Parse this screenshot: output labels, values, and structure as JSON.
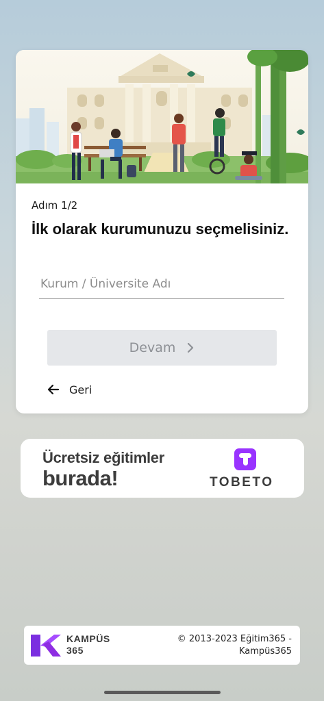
{
  "card": {
    "step_label": "Adım 1/2",
    "title": "İlk olarak kurumunuzu seçmelisiniz.",
    "institution_input": {
      "placeholder": "Kurum / Üniversite Adı",
      "value": ""
    },
    "continue_label": "Devam",
    "back_label": "Geri"
  },
  "banner": {
    "line1": "Ücretsiz eğitimler",
    "line2": "burada!",
    "brand": "TOBETO",
    "brand_color": "#9933ff"
  },
  "footer": {
    "brand_line1": "KAMPÜS",
    "brand_line2": "365",
    "copyright": "© 2013-2023 Eğitim365 - Kampüs365",
    "logo_color": "#8e2de2"
  },
  "icons": {
    "continue": "chevron-right-icon",
    "back": "arrow-left-icon"
  }
}
